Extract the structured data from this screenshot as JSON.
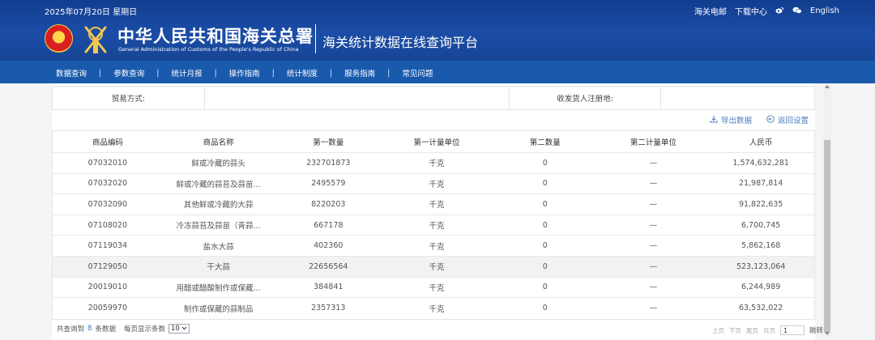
{
  "header": {
    "date": "2025年07月20日 星期日",
    "links": [
      "海关电邮",
      "下载中心",
      "English"
    ],
    "title_cn": "中华人民共和国海关总署",
    "title_en": "General Administration of Customs of the People's Republic of China",
    "platform": "海关统计数据在线查询平台",
    "colors": {
      "header_bg": "#1b4da6",
      "nav_bg": "#1a5aad"
    }
  },
  "nav": {
    "items": [
      "数据查询",
      "参数查询",
      "统计月报",
      "操作指南",
      "统计制度",
      "服务指南",
      "常见问题"
    ]
  },
  "filter": {
    "trade_mode_label": "贸易方式:",
    "trade_mode_value": "",
    "consignee_label": "收发货人注册地:",
    "consignee_value": ""
  },
  "actions": {
    "export": "导出数据",
    "reset": "返回设置"
  },
  "table": {
    "headers": [
      "商品编码",
      "商品名称",
      "第一数量",
      "第一计量单位",
      "第二数量",
      "第二计量单位",
      "人民币"
    ],
    "rows": [
      [
        "07032010",
        "鲜或冷藏的蒜头",
        "232701873",
        "千克",
        "0",
        "—",
        "1,574,632,281"
      ],
      [
        "07032020",
        "鲜或冷藏的蒜苔及蒜苗...",
        "2495579",
        "千克",
        "0",
        "—",
        "21,987,814"
      ],
      [
        "07032090",
        "其他鲜或冷藏的大蒜",
        "8220203",
        "千克",
        "0",
        "—",
        "91,822,635"
      ],
      [
        "07108020",
        "冷冻蒜苔及蒜苗（青蒜...",
        "667178",
        "千克",
        "0",
        "—",
        "6,700,745"
      ],
      [
        "07119034",
        "盐水大蒜",
        "402360",
        "千克",
        "0",
        "—",
        "5,862,168"
      ],
      [
        "07129050",
        "干大蒜",
        "22656564",
        "千克",
        "0",
        "—",
        "523,123,064"
      ],
      [
        "20019010",
        "用醋或醋酸制作或保藏...",
        "384841",
        "千克",
        "0",
        "—",
        "6,244,989"
      ],
      [
        "20059970",
        "制作或保藏的蒜制品",
        "2357313",
        "千克",
        "0",
        "—",
        "63,532,022"
      ]
    ]
  },
  "footer": {
    "total_prefix": "共查询到",
    "total_count": "8",
    "total_suffix": "条数据",
    "page_size_label": "每页显示条数",
    "page_size": "10",
    "pager": [
      "上页",
      "下页",
      "尾页",
      "共页"
    ],
    "page_input": "1",
    "goto": "跳转"
  }
}
